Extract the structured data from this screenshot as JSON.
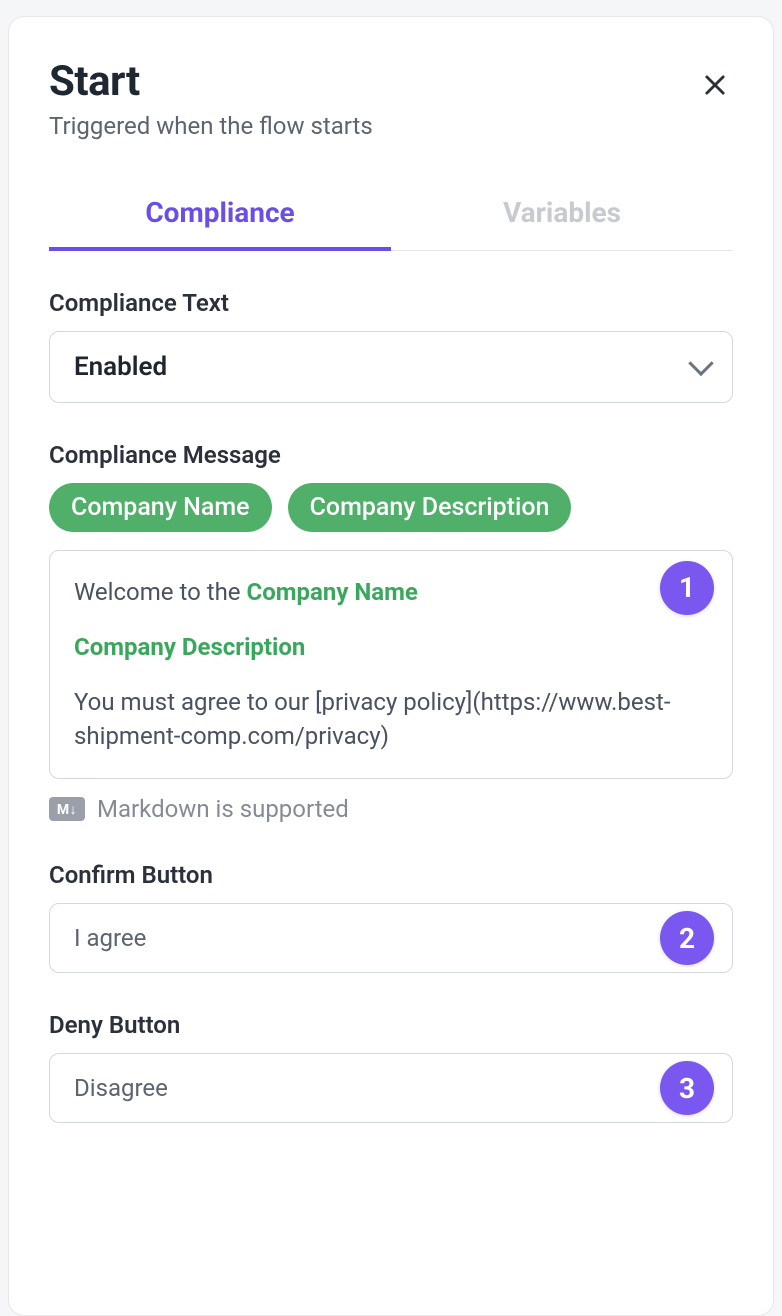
{
  "header": {
    "title": "Start",
    "subtitle": "Triggered when the flow starts"
  },
  "tabs": {
    "compliance": "Compliance",
    "variables": "Variables"
  },
  "compliance_text": {
    "label": "Compliance Text",
    "value": "Enabled"
  },
  "compliance_message": {
    "label": "Compliance Message",
    "tokens": {
      "company_name": "Company Name",
      "company_description": "Company Description"
    },
    "body": {
      "line1_prefix": "Welcome to the ",
      "line1_token": "Company Name",
      "line2_token": "Company Description",
      "line3": "You must agree to our [privacy policy](https://www.best-shipment-comp.com/privacy)"
    },
    "markdown_hint": "Markdown is supported",
    "markdown_badge": "M↓"
  },
  "confirm_button": {
    "label": "Confirm Button",
    "value": "I agree"
  },
  "deny_button": {
    "label": "Deny Button",
    "value": "Disagree"
  },
  "markers": {
    "one": "1",
    "two": "2",
    "three": "3"
  }
}
